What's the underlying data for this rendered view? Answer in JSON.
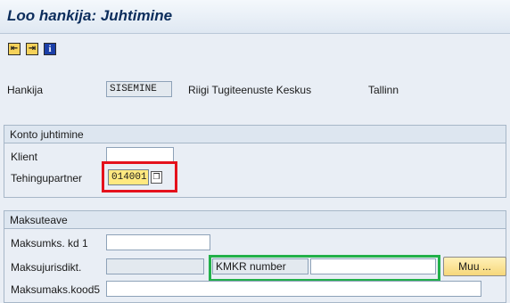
{
  "window": {
    "title": "Loo hankija: Juhtimine"
  },
  "toolbar": {
    "icons": [
      "previous-screen-icon",
      "next-screen-icon",
      "info-icon"
    ],
    "glyphs": [
      "⇤",
      "⇥",
      "i"
    ]
  },
  "header": {
    "vendor_label": "Hankija",
    "vendor_id": "SISEMINE",
    "vendor_name": "Riigi Tugiteenuste Keskus",
    "vendor_city": "Tallinn"
  },
  "account_control": {
    "title": "Konto juhtimine",
    "client_label": "Klient",
    "client_value": "",
    "partner_label": "Tehingupartner",
    "partner_value": "014001"
  },
  "tax_info": {
    "title": "Maksuteave",
    "tax_code1_label": "Maksumks. kd 1",
    "tax_code1_value": "",
    "jurisdiction_label": "Maksujurisdikt.",
    "jurisdiction_value": "",
    "kmkr_label": "KMKR number",
    "kmkr_value": "",
    "more_button": "Muu ...",
    "tax_code5_label": "Maksumaks.kood5",
    "tax_code5_value": ""
  },
  "colors": {
    "title": "#0c2d5c",
    "highlight_red": "#e4111c",
    "highlight_green": "#22b04a",
    "input_yellow": "#ffe980"
  }
}
